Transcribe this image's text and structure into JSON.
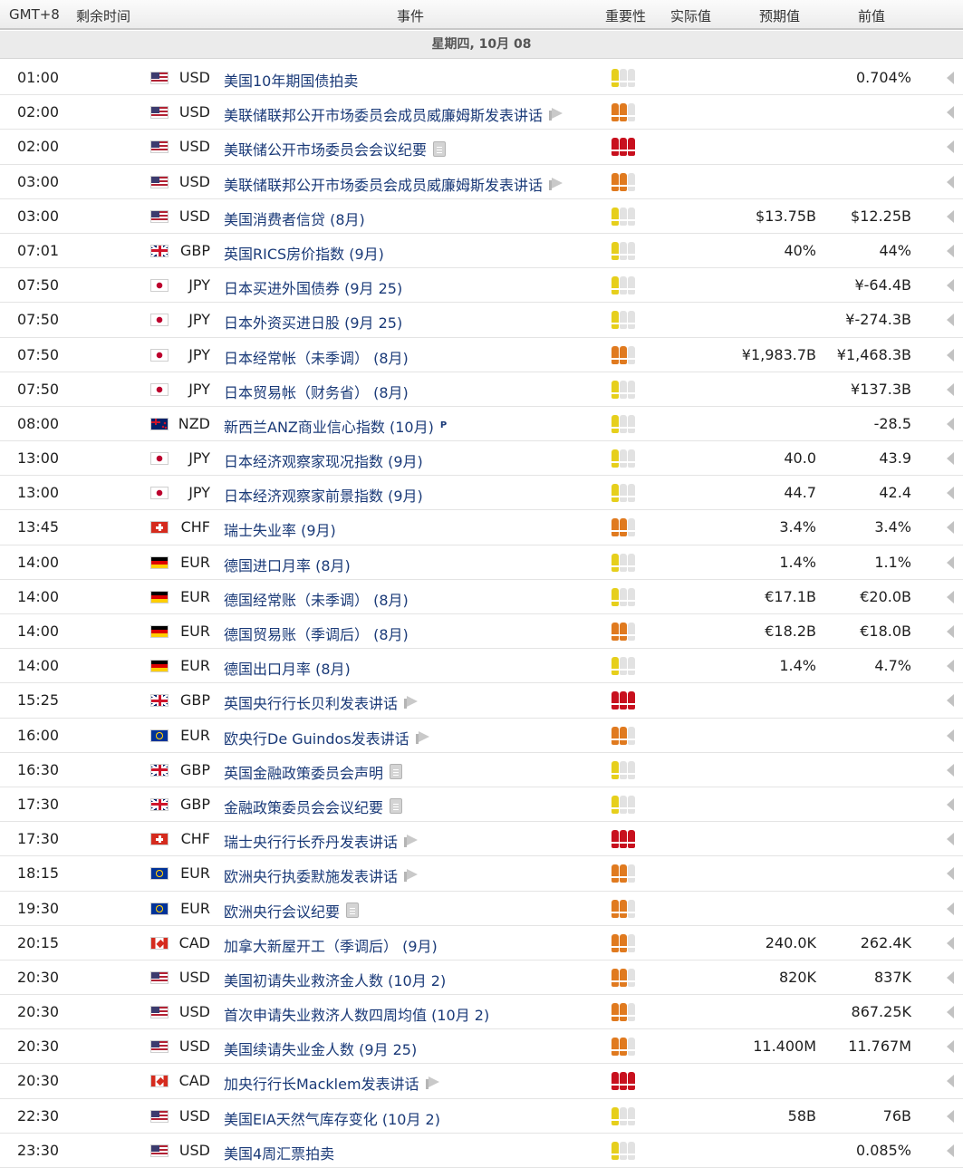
{
  "header": {
    "timezone": "GMT+8",
    "time_left": "剩余时间",
    "event": "事件",
    "importance": "重要性",
    "actual": "实际值",
    "forecast": "预期值",
    "previous": "前值"
  },
  "date_label": "星期四, 10月 08",
  "colors": {
    "importance_low": "#e6cf1c",
    "importance_medium": "#e07a1f",
    "importance_high": "#c8101e",
    "event_link": "#1a3a78"
  },
  "events": [
    {
      "time": "01:00",
      "currency": "USD",
      "flag": "us-flag-icon",
      "event": "美国10年期国债拍卖",
      "icon": "",
      "importance": 1,
      "actual": "",
      "forecast": "",
      "previous": "0.704%"
    },
    {
      "time": "02:00",
      "currency": "USD",
      "flag": "us-flag-icon",
      "event": "美联储联邦公开市场委员会成员威廉姆斯发表讲话",
      "icon": "speech-icon",
      "importance": 2,
      "actual": "",
      "forecast": "",
      "previous": ""
    },
    {
      "time": "02:00",
      "currency": "USD",
      "flag": "us-flag-icon",
      "event": "美联储公开市场委员会会议纪要",
      "icon": "report-icon",
      "importance": 3,
      "actual": "",
      "forecast": "",
      "previous": ""
    },
    {
      "time": "03:00",
      "currency": "USD",
      "flag": "us-flag-icon",
      "event": "美联储联邦公开市场委员会成员威廉姆斯发表讲话",
      "icon": "speech-icon",
      "importance": 2,
      "actual": "",
      "forecast": "",
      "previous": ""
    },
    {
      "time": "03:00",
      "currency": "USD",
      "flag": "us-flag-icon",
      "event": "美国消费者信贷 (8月)",
      "icon": "",
      "importance": 1,
      "actual": "",
      "forecast": "$13.75B",
      "previous": "$12.25B"
    },
    {
      "time": "07:01",
      "currency": "GBP",
      "flag": "uk-flag-icon",
      "event": "英国RICS房价指数 (9月)",
      "icon": "",
      "importance": 1,
      "actual": "",
      "forecast": "40%",
      "previous": "44%"
    },
    {
      "time": "07:50",
      "currency": "JPY",
      "flag": "japan-flag-icon",
      "event": "日本买进外国债券 (9月 25)",
      "icon": "",
      "importance": 1,
      "actual": "",
      "forecast": "",
      "previous": "¥-64.4B"
    },
    {
      "time": "07:50",
      "currency": "JPY",
      "flag": "japan-flag-icon",
      "event": "日本外资买进日股 (9月 25)",
      "icon": "",
      "importance": 1,
      "actual": "",
      "forecast": "",
      "previous": "¥-274.3B"
    },
    {
      "time": "07:50",
      "currency": "JPY",
      "flag": "japan-flag-icon",
      "event": "日本经常帐（未季调） (8月)",
      "icon": "",
      "importance": 2,
      "actual": "",
      "forecast": "¥1,983.7B",
      "previous": "¥1,468.3B"
    },
    {
      "time": "07:50",
      "currency": "JPY",
      "flag": "japan-flag-icon",
      "event": "日本贸易帐（财务省） (8月)",
      "icon": "",
      "importance": 1,
      "actual": "",
      "forecast": "",
      "previous": "¥137.3B"
    },
    {
      "time": "08:00",
      "currency": "NZD",
      "flag": "new-zealand-flag-icon",
      "event": "新西兰ANZ商业信心指数 (10月)",
      "icon": "preliminary-icon",
      "importance": 1,
      "actual": "",
      "forecast": "",
      "previous": "-28.5"
    },
    {
      "time": "13:00",
      "currency": "JPY",
      "flag": "japan-flag-icon",
      "event": "日本经济观察家现况指数 (9月)",
      "icon": "",
      "importance": 1,
      "actual": "",
      "forecast": "40.0",
      "previous": "43.9"
    },
    {
      "time": "13:00",
      "currency": "JPY",
      "flag": "japan-flag-icon",
      "event": "日本经济观察家前景指数 (9月)",
      "icon": "",
      "importance": 1,
      "actual": "",
      "forecast": "44.7",
      "previous": "42.4"
    },
    {
      "time": "13:45",
      "currency": "CHF",
      "flag": "swiss-flag-icon",
      "event": "瑞士失业率 (9月)",
      "icon": "",
      "importance": 2,
      "actual": "",
      "forecast": "3.4%",
      "previous": "3.4%"
    },
    {
      "time": "14:00",
      "currency": "EUR",
      "flag": "germany-flag-icon",
      "event": "德国进口月率 (8月)",
      "icon": "",
      "importance": 1,
      "actual": "",
      "forecast": "1.4%",
      "previous": "1.1%"
    },
    {
      "time": "14:00",
      "currency": "EUR",
      "flag": "germany-flag-icon",
      "event": "德国经常账（未季调） (8月)",
      "icon": "",
      "importance": 1,
      "actual": "",
      "forecast": "€17.1B",
      "previous": "€20.0B"
    },
    {
      "time": "14:00",
      "currency": "EUR",
      "flag": "germany-flag-icon",
      "event": "德国贸易账（季调后） (8月)",
      "icon": "",
      "importance": 2,
      "actual": "",
      "forecast": "€18.2B",
      "previous": "€18.0B"
    },
    {
      "time": "14:00",
      "currency": "EUR",
      "flag": "germany-flag-icon",
      "event": "德国出口月率 (8月)",
      "icon": "",
      "importance": 1,
      "actual": "",
      "forecast": "1.4%",
      "previous": "4.7%"
    },
    {
      "time": "15:25",
      "currency": "GBP",
      "flag": "uk-flag-icon",
      "event": "英国央行行长贝利发表讲话",
      "icon": "speech-icon",
      "importance": 3,
      "actual": "",
      "forecast": "",
      "previous": ""
    },
    {
      "time": "16:00",
      "currency": "EUR",
      "flag": "eu-flag-icon",
      "event": "欧央行De Guindos发表讲话",
      "icon": "speech-icon",
      "importance": 2,
      "actual": "",
      "forecast": "",
      "previous": ""
    },
    {
      "time": "16:30",
      "currency": "GBP",
      "flag": "uk-flag-icon",
      "event": "英国金融政策委员会声明",
      "icon": "report-icon",
      "importance": 1,
      "actual": "",
      "forecast": "",
      "previous": ""
    },
    {
      "time": "17:30",
      "currency": "GBP",
      "flag": "uk-flag-icon",
      "event": "金融政策委员会会议纪要",
      "icon": "report-icon",
      "importance": 1,
      "actual": "",
      "forecast": "",
      "previous": ""
    },
    {
      "time": "17:30",
      "currency": "CHF",
      "flag": "swiss-flag-icon",
      "event": "瑞士央行行长乔丹发表讲话",
      "icon": "speech-icon",
      "importance": 3,
      "actual": "",
      "forecast": "",
      "previous": ""
    },
    {
      "time": "18:15",
      "currency": "EUR",
      "flag": "eu-flag-icon",
      "event": "欧洲央行执委默施发表讲话",
      "icon": "speech-icon",
      "importance": 2,
      "actual": "",
      "forecast": "",
      "previous": ""
    },
    {
      "time": "19:30",
      "currency": "EUR",
      "flag": "eu-flag-icon",
      "event": "欧洲央行会议纪要",
      "icon": "report-icon",
      "importance": 2,
      "actual": "",
      "forecast": "",
      "previous": ""
    },
    {
      "time": "20:15",
      "currency": "CAD",
      "flag": "canada-flag-icon",
      "event": "加拿大新屋开工（季调后） (9月)",
      "icon": "",
      "importance": 2,
      "actual": "",
      "forecast": "240.0K",
      "previous": "262.4K"
    },
    {
      "time": "20:30",
      "currency": "USD",
      "flag": "us-flag-icon",
      "event": "美国初请失业救济金人数 (10月 2)",
      "icon": "",
      "importance": 2,
      "actual": "",
      "forecast": "820K",
      "previous": "837K"
    },
    {
      "time": "20:30",
      "currency": "USD",
      "flag": "us-flag-icon",
      "event": "首次申请失业救济人数四周均值 (10月 2)",
      "icon": "",
      "importance": 2,
      "actual": "",
      "forecast": "",
      "previous": "867.25K"
    },
    {
      "time": "20:30",
      "currency": "USD",
      "flag": "us-flag-icon",
      "event": "美国续请失业金人数 (9月 25)",
      "icon": "",
      "importance": 2,
      "actual": "",
      "forecast": "11.400M",
      "previous": "11.767M"
    },
    {
      "time": "20:30",
      "currency": "CAD",
      "flag": "canada-flag-icon",
      "event": "加央行行长Macklem发表讲话",
      "icon": "speech-icon",
      "importance": 3,
      "actual": "",
      "forecast": "",
      "previous": ""
    },
    {
      "time": "22:30",
      "currency": "USD",
      "flag": "us-flag-icon",
      "event": "美国EIA天然气库存变化 (10月 2)",
      "icon": "",
      "importance": 1,
      "actual": "",
      "forecast": "58B",
      "previous": "76B"
    },
    {
      "time": "23:30",
      "currency": "USD",
      "flag": "us-flag-icon",
      "event": "美国4周汇票拍卖",
      "icon": "",
      "importance": 1,
      "actual": "",
      "forecast": "",
      "previous": "0.085%"
    }
  ]
}
